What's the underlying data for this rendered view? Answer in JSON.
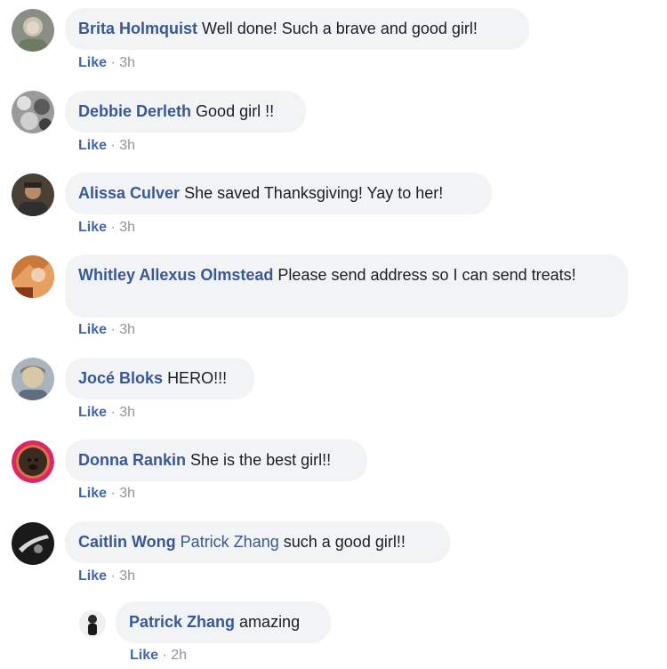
{
  "comments": [
    {
      "author": "Brita Holmquist",
      "text": "Well done! Such a brave and good girl!",
      "like": "Like",
      "sep": "·",
      "time": "3h"
    },
    {
      "author": "Debbie Derleth",
      "text": "Good girl !!",
      "like": "Like",
      "sep": "·",
      "time": "3h"
    },
    {
      "author": "Alissa Culver",
      "text": "She saved Thanksgiving! Yay to her!",
      "like": "Like",
      "sep": "·",
      "time": "3h"
    },
    {
      "author": "Whitley Allexus Olmstead",
      "text": "Please send address so I can send treats!",
      "like": "Like",
      "sep": "·",
      "time": "3h"
    },
    {
      "author": "Jocé Bloks",
      "text": "HERO!!!",
      "like": "Like",
      "sep": "·",
      "time": "3h"
    },
    {
      "author": "Donna Rankin",
      "text": "She is the best girl!!",
      "like": "Like",
      "sep": "·",
      "time": "3h"
    },
    {
      "author": "Caitlin Wong",
      "mention": "Patrick Zhang",
      "text": "such a good girl!!",
      "like": "Like",
      "sep": "·",
      "time": "3h"
    }
  ],
  "reply": {
    "author": "Patrick Zhang",
    "text": "amazing",
    "like": "Like",
    "sep": "·",
    "time": "2h"
  },
  "colors": {
    "author_link": "#385898",
    "like_link": "#4267b2",
    "bubble_bg": "#f2f3f5",
    "meta_gray": "#90949c"
  }
}
